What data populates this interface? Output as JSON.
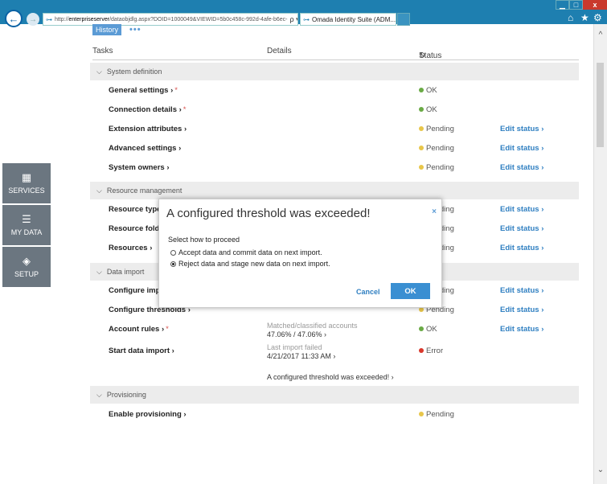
{
  "browser": {
    "address_prefix": "http://",
    "address_host": "enterpriseserver",
    "address_rest": "/dataobjdlg.aspx?DOID=1000049&VIEWID=5b0c458c-992d-4afe-b6ec-",
    "address_controls": "ρ ▾ ↻",
    "tab_title": "Omada Identity Suite (ADM...",
    "tab_close": "×",
    "window_min": "▁",
    "window_max": "□",
    "window_close": "x",
    "back_glyph": "←",
    "forward_glyph": "→",
    "icon_home": "⌂",
    "icon_favorites": "★",
    "icon_settings": "⚙"
  },
  "leftnav": [
    {
      "label": "SERVICES",
      "icon": "▦"
    },
    {
      "label": "MY DATA",
      "icon": "☰"
    },
    {
      "label": "SETUP",
      "icon": "◈"
    }
  ],
  "history": {
    "label": "History",
    "more": "•••"
  },
  "table": {
    "headers": {
      "tasks": "Tasks",
      "details": "Details",
      "status": "Status",
      "status_icon": "↻"
    },
    "sections": [
      {
        "title": "System definition",
        "chevron": "⌵"
      },
      {
        "title": "Resource management",
        "chevron": "⌵"
      },
      {
        "title": "Data import",
        "chevron": "⌵"
      },
      {
        "title": "Provisioning",
        "chevron": "⌵"
      }
    ],
    "rows": [
      {
        "task": "General settings ›",
        "star": "*",
        "status": "OK",
        "edit": ""
      },
      {
        "task": "Connection details ›",
        "star": "*",
        "status": "OK",
        "edit": ""
      },
      {
        "task": "Extension attributes ›",
        "star": "",
        "status": "Pending",
        "edit": "Edit status ›"
      },
      {
        "task": "Advanced settings ›",
        "star": "",
        "status": "Pending",
        "edit": "Edit status ›"
      },
      {
        "task": "System owners ›",
        "star": "",
        "status": "Pending",
        "edit": "Edit status ›"
      },
      {
        "task": "Resource types ›",
        "star": "",
        "status": "Pending",
        "edit": "Edit status ›"
      },
      {
        "task": "Resource folders ›",
        "star": "",
        "status": "Pending",
        "edit": "Edit status ›"
      },
      {
        "task": "Resources ›",
        "star": "",
        "status": "Pending",
        "edit": "Edit status ›"
      },
      {
        "task": "Configure import ›",
        "star": "",
        "status": "Pending",
        "edit": "Edit status ›"
      },
      {
        "task": "Configure thresholds ›",
        "star": "",
        "status": "Pending",
        "edit": "Edit status ›"
      },
      {
        "task": "Account rules ›",
        "star": "*",
        "details_label": "Matched/classified accounts",
        "details_value": "47.06% / 47.06% ›",
        "status": "OK",
        "edit": "Edit status ›"
      },
      {
        "task": "Start data import ›",
        "star": "",
        "details_label": "Last import failed",
        "details_value": "4/21/2017 11:33 AM ›",
        "status": "Error",
        "edit": ""
      },
      {
        "task": "Enable provisioning ›",
        "star": "",
        "status": "Pending",
        "edit": ""
      }
    ],
    "threshold_link": "A configured threshold was exceeded! ›"
  },
  "modal": {
    "title": "A configured threshold was exceeded!",
    "close": "×",
    "prompt": "Select how to proceed",
    "options": [
      {
        "label": "Accept data and commit data on next import.",
        "selected": false
      },
      {
        "label": "Reject data and stage new data on next import.",
        "selected": true
      }
    ],
    "cancel": "Cancel",
    "ok": "OK"
  },
  "scrollbar": {
    "up": "^",
    "down": "⌄"
  },
  "colors": {
    "accent": "#3a8fd2",
    "nav": "#6b7680",
    "ok": "#6aaa45",
    "pending": "#e8c64a",
    "error": "#d9372b"
  }
}
